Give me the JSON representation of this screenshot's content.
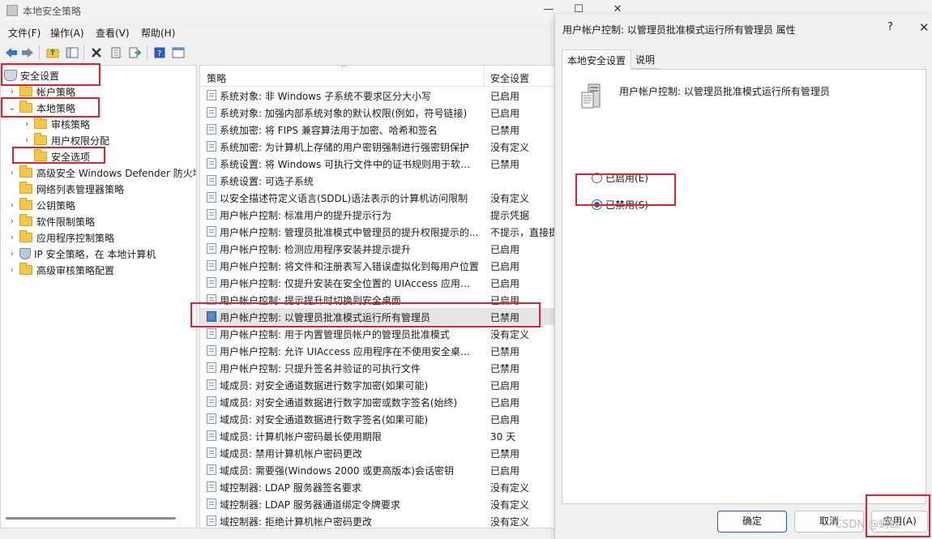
{
  "main_window": {
    "title": "本地安全策略",
    "controls": {
      "minimize": "—",
      "maximize": "☐",
      "close": "✕"
    },
    "menu": [
      "文件(F)",
      "操作(A)",
      "查看(V)",
      "帮助(H)"
    ]
  },
  "toolbar": {
    "icons": [
      "back-icon",
      "forward-icon",
      "up-folder-icon",
      "show-hide-tree-icon",
      "delete-icon",
      "properties-icon",
      "export-icon",
      "help-icon",
      "console-icon"
    ]
  },
  "tree": {
    "root": "安全设置",
    "items": [
      {
        "label": "帐户策略",
        "level": 1,
        "expanded": false
      },
      {
        "label": "本地策略",
        "level": 1,
        "expanded": true
      },
      {
        "label": "审核策略",
        "level": 2,
        "expanded": false
      },
      {
        "label": "用户权限分配",
        "level": 2,
        "expanded": false
      },
      {
        "label": "安全选项",
        "level": 2,
        "selected": true
      },
      {
        "label": "高级安全 Windows Defender 防火墙",
        "level": 1,
        "expanded": false
      },
      {
        "label": "网络列表管理器策略",
        "level": 1
      },
      {
        "label": "公钥策略",
        "level": 1,
        "expanded": false
      },
      {
        "label": "软件限制策略",
        "level": 1,
        "expanded": false
      },
      {
        "label": "应用程序控制策略",
        "level": 1,
        "expanded": false
      },
      {
        "label": "IP 安全策略，在 本地计算机",
        "level": 1,
        "expanded": false
      },
      {
        "label": "高级审核策略配置",
        "level": 1,
        "expanded": false
      }
    ]
  },
  "policy_list": {
    "columns": [
      "策略",
      "安全设置"
    ],
    "rows": [
      {
        "name": "系统对象: 非 Windows 子系统不要求区分大小写",
        "setting": "已启用"
      },
      {
        "name": "系统对象: 加强内部系统对象的默认权限(例如，符号链接)",
        "setting": "已启用"
      },
      {
        "name": "系统加密: 将 FIPS 兼容算法用于加密、哈希和签名",
        "setting": "已禁用"
      },
      {
        "name": "系统加密: 为计算机上存储的用户密钥强制进行强密钥保护",
        "setting": "没有定义"
      },
      {
        "name": "系统设置: 将 Windows 可执行文件中的证书规则用于软件...",
        "setting": "已禁用"
      },
      {
        "name": "系统设置: 可选子系统",
        "setting": ""
      },
      {
        "name": "以安全描述符定义语言(SDDL)语法表示的计算机访问限制",
        "setting": "没有定义"
      },
      {
        "name": "用户帐户控制: 标准用户的提升提示行为",
        "setting": "提示凭据"
      },
      {
        "name": "用户帐户控制: 管理员批准模式中管理员的提升权限提示的...",
        "setting": "不提示，直接提"
      },
      {
        "name": "用户帐户控制: 检测应用程序安装并提示提升",
        "setting": "已启用"
      },
      {
        "name": "用户帐户控制: 将文件和注册表写入错误虚拟化到每用户位置",
        "setting": "已启用"
      },
      {
        "name": "用户帐户控制: 仅提升安装在安全位置的 UIAccess 应用程序",
        "setting": "已启用"
      },
      {
        "name": "用户帐户控制: 提示提升时切换到安全桌面",
        "setting": "已启用"
      },
      {
        "name": "用户帐户控制: 以管理员批准模式运行所有管理员",
        "setting": "已禁用",
        "selected": true
      },
      {
        "name": "用户帐户控制: 用于内置管理员帐户的管理员批准模式",
        "setting": "没有定义"
      },
      {
        "name": "用户帐户控制: 允许 UIAccess 应用程序在不使用安全桌面...",
        "setting": "已禁用"
      },
      {
        "name": "用户帐户控制: 只提升签名并验证的可执行文件",
        "setting": "已禁用"
      },
      {
        "name": "域成员: 对安全通道数据进行数字加密(如果可能)",
        "setting": "已启用"
      },
      {
        "name": "域成员: 对安全通道数据进行数字加密或数字签名(始终)",
        "setting": "已启用"
      },
      {
        "name": "域成员: 对安全通道数据进行数字签名(如果可能)",
        "setting": "已启用"
      },
      {
        "name": "域成员: 计算机帐户密码最长使用期限",
        "setting": "30 天"
      },
      {
        "name": "域成员: 禁用计算机帐户密码更改",
        "setting": "已禁用"
      },
      {
        "name": "域成员: 需要强(Windows 2000 或更高版本)会话密钥",
        "setting": "已启用"
      },
      {
        "name": "域控制器: LDAP 服务器签名要求",
        "setting": "没有定义"
      },
      {
        "name": "域控制器: LDAP 服务器通道绑定令牌要求",
        "setting": "没有定义"
      },
      {
        "name": "域控制器: 拒绝计算机帐户密码更改",
        "setting": "没有定义"
      }
    ]
  },
  "dialog": {
    "title": "用户帐户控制: 以管理员批准模式运行所有管理员 属性",
    "help": "?",
    "close": "✕",
    "tabs": [
      "本地安全设置",
      "说明"
    ],
    "policy_name": "用户帐户控制: 以管理员批准模式运行所有管理员",
    "options": [
      {
        "label": "已启用(E)",
        "checked": false
      },
      {
        "label": "已禁用(S)",
        "checked": true
      }
    ],
    "buttons": {
      "ok": "确定",
      "cancel": "取消",
      "apply": "应用(A)"
    }
  },
  "watermark": "CSDN @蚂蚁",
  "colors": {
    "highlight_red": "#e3202c",
    "accent_blue": "#1a5fb4"
  }
}
